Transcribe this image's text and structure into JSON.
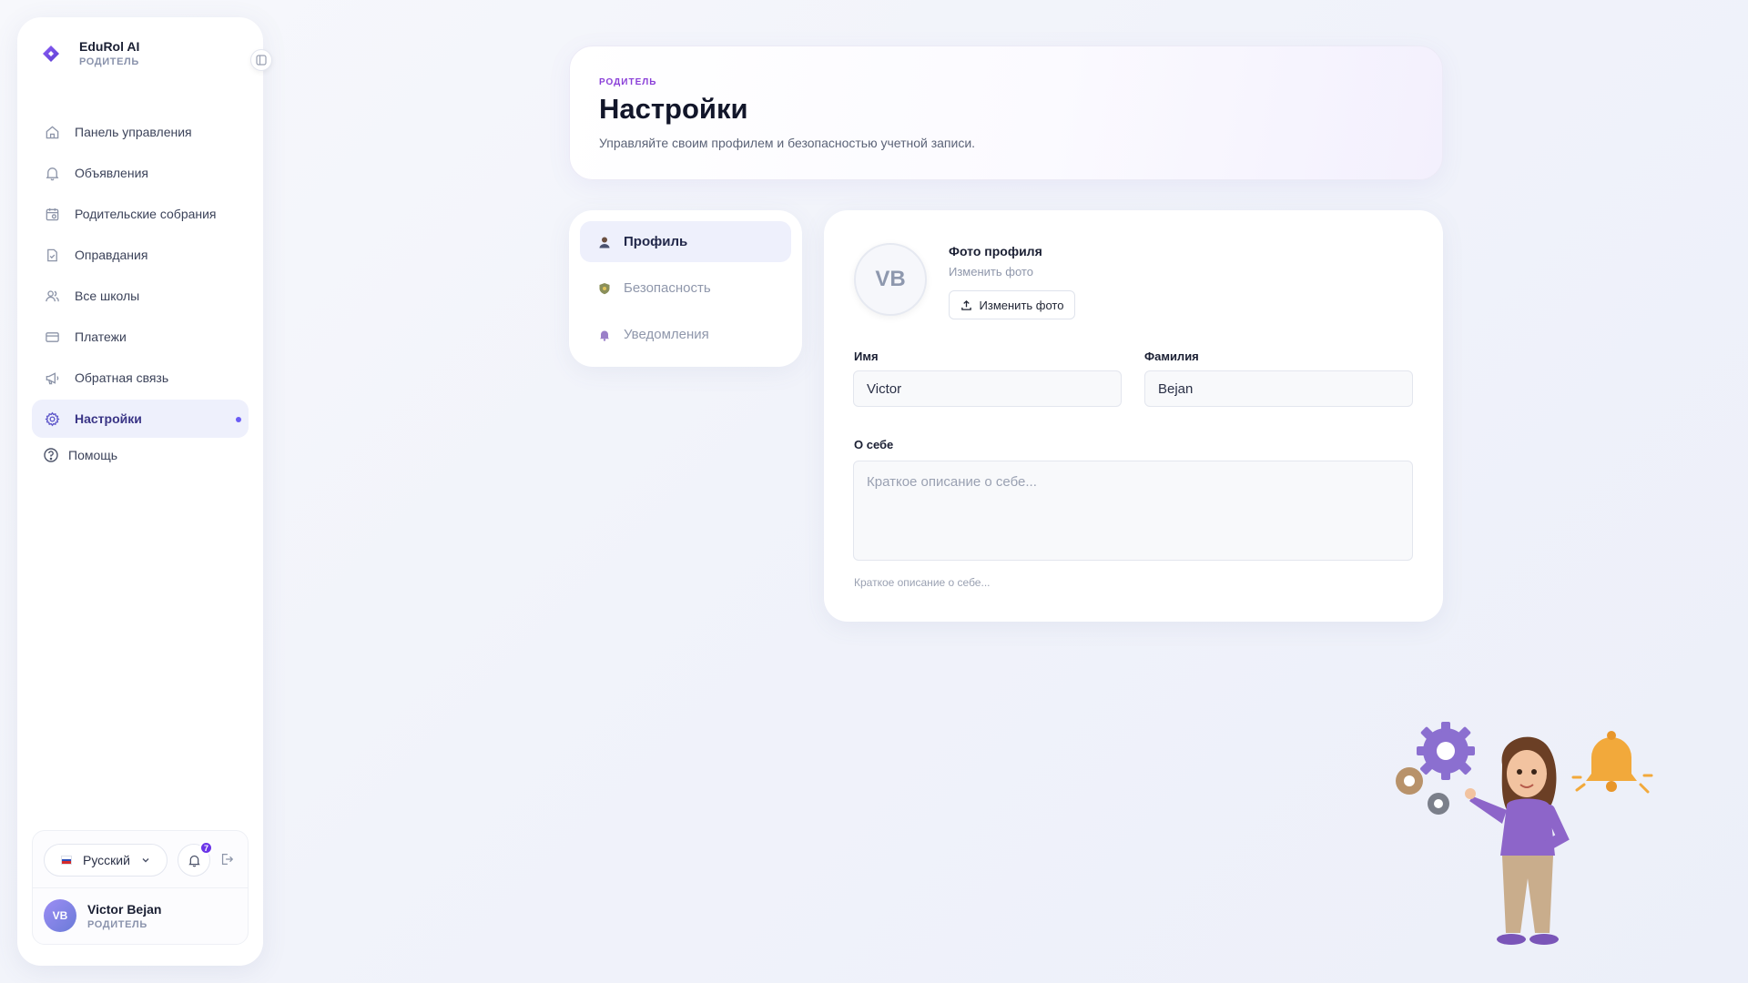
{
  "app": {
    "name": "EduRol AI",
    "role": "РОДИТЕЛЬ"
  },
  "sidebar": {
    "items": [
      {
        "label": "Панель управления",
        "icon": "home-icon"
      },
      {
        "label": "Объявления",
        "icon": "bell-icon"
      },
      {
        "label": "Родительские собрания",
        "icon": "calendar-icon"
      },
      {
        "label": "Оправдания",
        "icon": "document-icon"
      },
      {
        "label": "Все школы",
        "icon": "users-icon"
      },
      {
        "label": "Платежи",
        "icon": "card-icon"
      },
      {
        "label": "Обратная связь",
        "icon": "megaphone-icon"
      },
      {
        "label": "Настройки",
        "icon": "gear-icon",
        "active": true
      }
    ],
    "help_label": "Помощь",
    "language": "Русский",
    "notification_count": "7",
    "user": {
      "initials": "VB",
      "name": "Victor Bejan",
      "role": "РОДИТЕЛЬ"
    }
  },
  "header": {
    "eyebrow": "РОДИТЕЛЬ",
    "title": "Настройки",
    "subtitle": "Управляйте своим профилем и безопасностью учетной записи."
  },
  "tabs": [
    {
      "label": "Профиль",
      "active": true
    },
    {
      "label": "Безопасность",
      "active": false
    },
    {
      "label": "Уведомления",
      "active": false
    }
  ],
  "profile": {
    "avatar_initials": "VB",
    "photo_title": "Фото профиля",
    "photo_subtitle": "Изменить фото",
    "photo_button": "Изменить фото",
    "first_name_label": "Имя",
    "first_name_value": "Victor",
    "last_name_label": "Фамилия",
    "last_name_value": "Bejan",
    "about_label": "О себе",
    "about_placeholder": "Краткое описание о себе...",
    "about_hint": "Краткое описание о себе..."
  },
  "colors": {
    "accent": "#6a5cf5",
    "active_bg": "#eef0fc",
    "eyebrow": "#8a3fd8",
    "badge": "#6b35e8"
  }
}
